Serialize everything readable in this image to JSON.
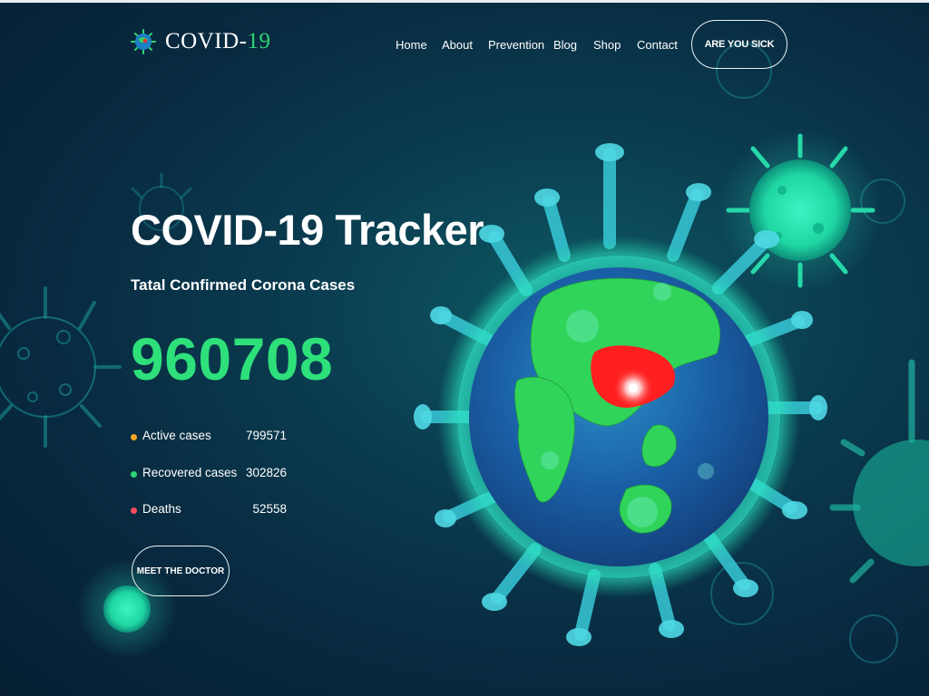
{
  "brand": {
    "name": "COVID-",
    "name_accent": "19",
    "icon": "virus-logo-icon"
  },
  "nav": {
    "items": [
      "Home",
      "About",
      "Prevention",
      "Blog",
      "Shop",
      "Contact"
    ]
  },
  "cta_sick": "ARE YOU SICK",
  "hero": {
    "title": "COVID-19 Tracker",
    "subtitle": "Tatal Confirmed Corona Cases",
    "total": "960708",
    "stats": [
      {
        "label": "Active cases",
        "value": "799571",
        "color": "#f5a623"
      },
      {
        "label": "Recovered cases",
        "value": "302826",
        "color": "#2ed573"
      },
      {
        "label": "Deaths",
        "value": "52558",
        "color": "#ff4d5e"
      }
    ],
    "cta_doctor": "MEET THE DOCTOR"
  },
  "colors": {
    "accent": "#2ee07a",
    "background": "#082a40",
    "hotspot": "#ff1f1f"
  }
}
